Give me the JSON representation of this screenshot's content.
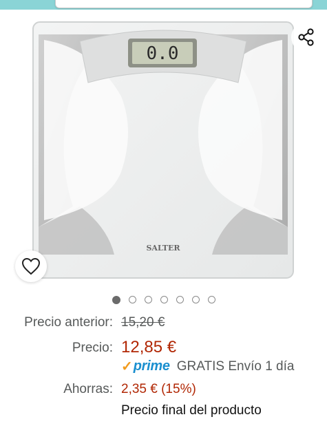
{
  "header": {
    "search_placeholder": ""
  },
  "gallery": {
    "product_alt": "Báscula de baño Salter",
    "brand_on_product": "SALTER",
    "display_reading": "0.0",
    "image_count": 7,
    "active_index": 0
  },
  "pricing": {
    "previous_label": "Precio anterior:",
    "previous_value": "15,20 €",
    "price_label": "Precio:",
    "price_value": "12,85 €",
    "prime_logo": "prime",
    "shipping_text": "GRATIS Envío 1 día",
    "savings_label": "Ahorras:",
    "savings_value": "2,35 € (15%)",
    "final_note": "Precio final del producto"
  },
  "colors": {
    "price": "#b12704",
    "prime_blue": "#1a8fcf",
    "prime_check": "#f29b1d",
    "top_bar": "#8ad4d6"
  },
  "icons": [
    "share-icon",
    "heart-icon",
    "prime-check-icon"
  ]
}
